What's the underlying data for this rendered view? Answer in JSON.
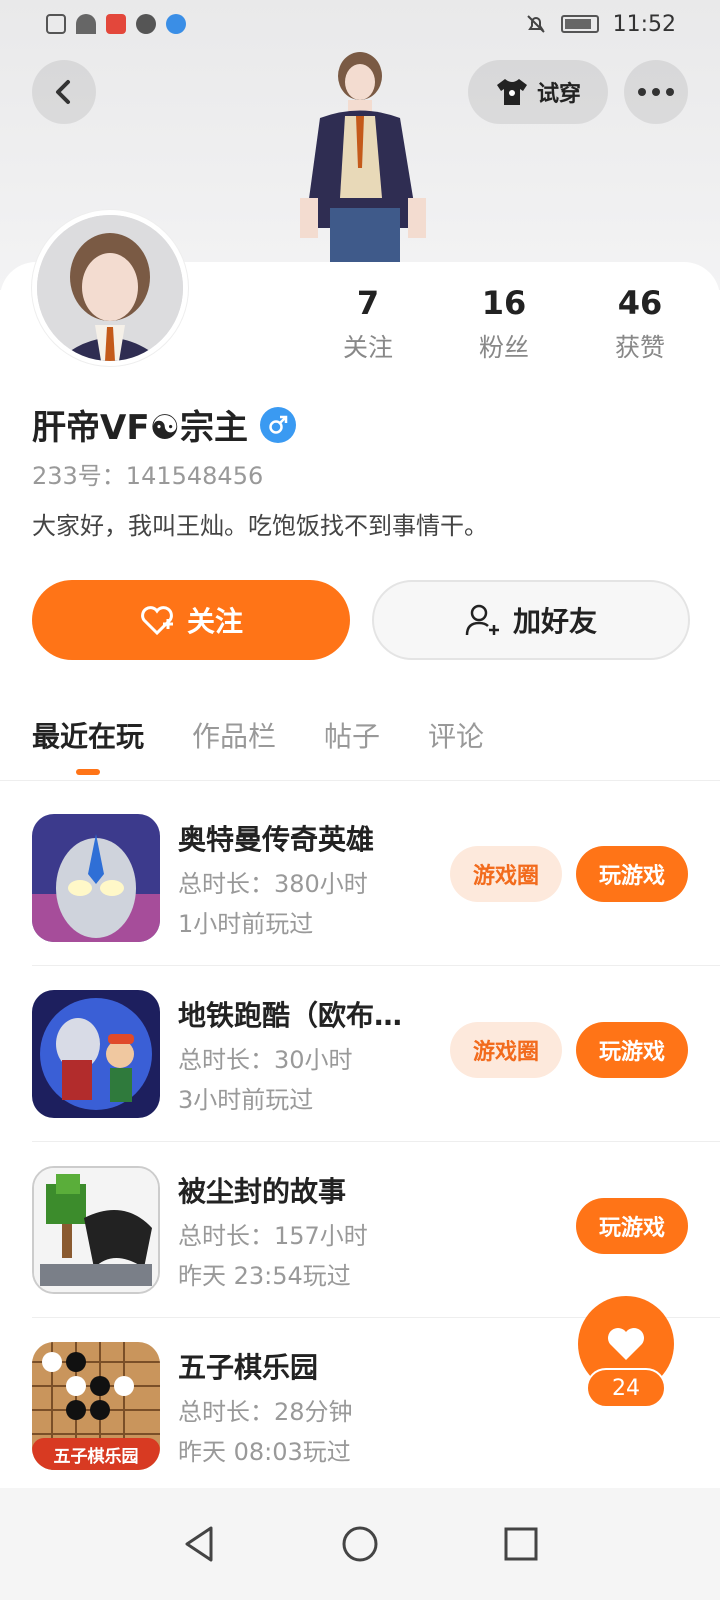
{
  "status_bar": {
    "time": "11:52"
  },
  "header": {
    "try_on_label": "试穿"
  },
  "profile": {
    "name": "肝帝VF☯宗主",
    "uid": "233号：141548456",
    "bio": "大家好，我叫王灿。吃饱饭找不到事情干。",
    "stats": [
      {
        "value": "7",
        "label": "关注"
      },
      {
        "value": "16",
        "label": "粉丝"
      },
      {
        "value": "46",
        "label": "获赞"
      }
    ]
  },
  "actions": {
    "follow_label": "关注",
    "add_friend_label": "加好友"
  },
  "tabs": [
    {
      "label": "最近在玩",
      "active": true
    },
    {
      "label": "作品栏",
      "active": false
    },
    {
      "label": "帖子",
      "active": false
    },
    {
      "label": "评论",
      "active": false
    }
  ],
  "games": [
    {
      "title": "奥特曼传奇英雄",
      "duration": "总时长：380小时",
      "last_played": "1小时前玩过",
      "circle_label": "游戏圈",
      "play_label": "玩游戏",
      "icon": "ultraman-game-icon"
    },
    {
      "title": "地铁跑酷（欧布…",
      "duration": "总时长：30小时",
      "last_played": "3小时前玩过",
      "circle_label": "游戏圈",
      "play_label": "玩游戏",
      "icon": "subway-surfers-icon"
    },
    {
      "title": "被尘封的故事",
      "duration": "总时长：157小时",
      "last_played": "昨天 23:54玩过",
      "circle_label": "",
      "play_label": "玩游戏",
      "icon": "dusty-story-icon"
    },
    {
      "title": "五子棋乐园",
      "duration": "总时长：28分钟",
      "last_played": "昨天 08:03玩过",
      "circle_label": "",
      "play_label": "",
      "icon": "gomoku-icon",
      "icon_text": "五子棋乐园"
    }
  ],
  "like_fab": {
    "count": "24"
  },
  "colors": {
    "accent": "#ff7417",
    "circle_bg": "#fde9dc",
    "gender_blue": "#3a9af2"
  }
}
